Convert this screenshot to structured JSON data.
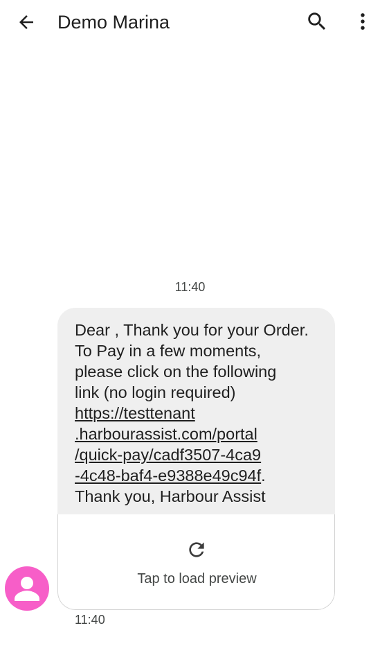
{
  "header": {
    "title": "Demo Marina",
    "back_icon": "arrow-back-icon",
    "search_icon": "search-icon",
    "more_icon": "more-vert-icon"
  },
  "conversation": {
    "date_separator": "11:40",
    "message": {
      "text_before_link": "Dear , Thank you for your Order.\nTo Pay in a few moments,\nplease click on the following\nlink (no login required)\n",
      "link_text": "https://testtenant\n.harbourassist.com/portal\n/quick-pay/cadf3507-4ca9\n-4c48-baf4-e9388e49c94f",
      "text_after_link": ".\nThank you, Harbour Assist",
      "timestamp": "11:40",
      "bubble_color": "#efefef"
    },
    "link_preview": {
      "label": "Tap to load preview",
      "icon": "refresh-icon"
    },
    "avatar": {
      "icon": "person-icon",
      "color": "#f75ec8"
    }
  }
}
